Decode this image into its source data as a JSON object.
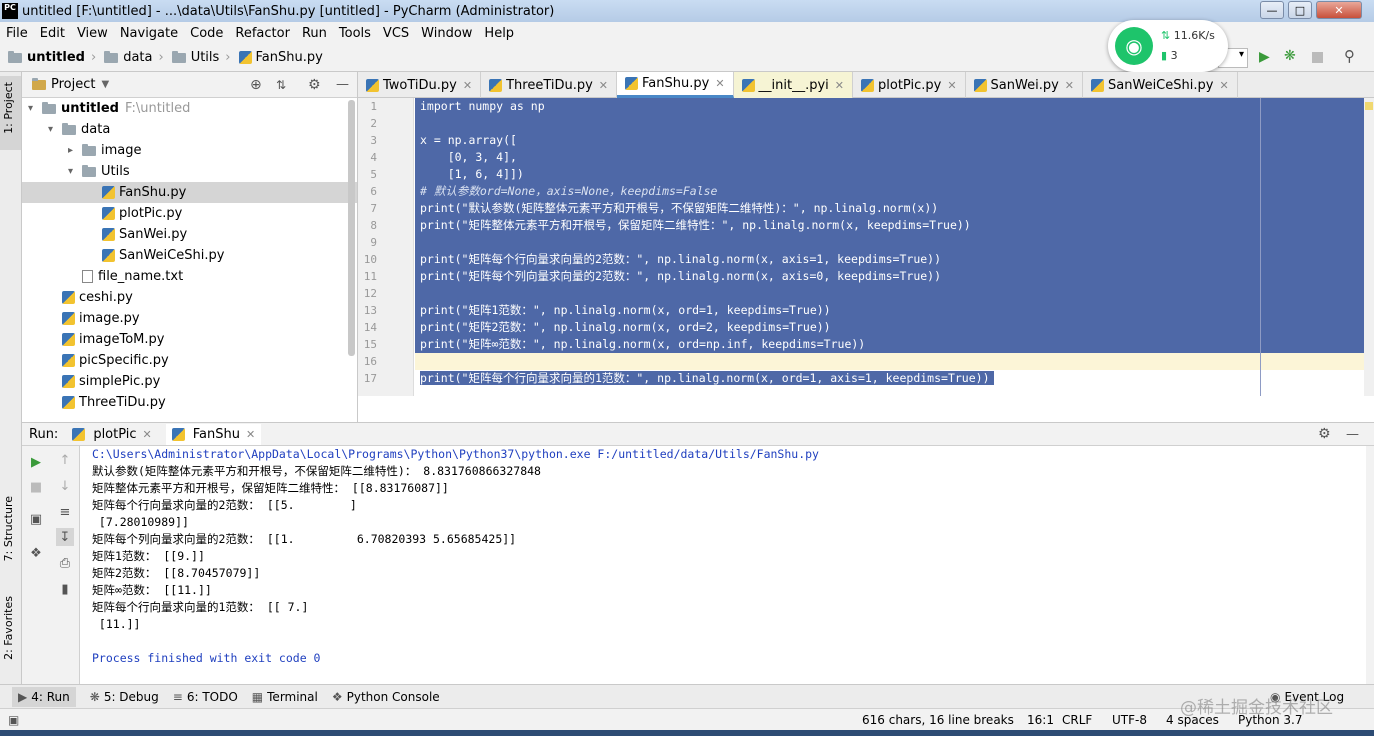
{
  "window": {
    "title": "untitled [F:\\untitled] - ...\\data\\Utils\\FanShu.py [untitled] - PyCharm (Administrator)",
    "app_icon": "PC",
    "controls": [
      "minimize",
      "maximize",
      "close"
    ]
  },
  "menu": [
    "File",
    "Edit",
    "View",
    "Navigate",
    "Code",
    "Refactor",
    "Run",
    "Tools",
    "VCS",
    "Window",
    "Help"
  ],
  "breadcrumb": [
    "untitled",
    "data",
    "Utils",
    "FanShu.py"
  ],
  "network_widget": {
    "speed": "11.6K/s",
    "count": "3"
  },
  "project_panel": {
    "title": "Project",
    "tree": [
      {
        "label": "untitled",
        "path": "F:\\untitled",
        "depth": 0,
        "type": "folder",
        "expanded": true
      },
      {
        "label": "data",
        "depth": 1,
        "type": "folder",
        "expanded": true
      },
      {
        "label": "image",
        "depth": 2,
        "type": "folder",
        "expanded": false
      },
      {
        "label": "Utils",
        "depth": 2,
        "type": "folder",
        "expanded": true
      },
      {
        "label": "FanShu.py",
        "depth": 3,
        "type": "py",
        "selected": true
      },
      {
        "label": "plotPic.py",
        "depth": 3,
        "type": "py"
      },
      {
        "label": "SanWei.py",
        "depth": 3,
        "type": "py"
      },
      {
        "label": "SanWeiCeShi.py",
        "depth": 3,
        "type": "py"
      },
      {
        "label": "file_name.txt",
        "depth": 2,
        "type": "txt"
      },
      {
        "label": "ceshi.py",
        "depth": 1,
        "type": "py"
      },
      {
        "label": "image.py",
        "depth": 1,
        "type": "py"
      },
      {
        "label": "imageToM.py",
        "depth": 1,
        "type": "py"
      },
      {
        "label": "picSpecific.py",
        "depth": 1,
        "type": "py"
      },
      {
        "label": "simplePic.py",
        "depth": 1,
        "type": "py"
      },
      {
        "label": "ThreeTiDu.py",
        "depth": 1,
        "type": "py"
      }
    ]
  },
  "side_tabs": {
    "project": "1: Project",
    "structure": "7: Structure",
    "favorites": "2: Favorites"
  },
  "editor_tabs": [
    {
      "label": "TwoTiDu.py"
    },
    {
      "label": "ThreeTiDu.py"
    },
    {
      "label": "FanShu.py",
      "active": true
    },
    {
      "label": "__init__.pyi"
    },
    {
      "label": "plotPic.py"
    },
    {
      "label": "SanWei.py"
    },
    {
      "label": "SanWeiCeShi.py"
    }
  ],
  "code_lines": [
    "import numpy as np",
    "",
    "x = np.array([",
    "    [0, 3, 4],",
    "    [1, 6, 4]])",
    "# 默认参数ord=None，axis=None，keepdims=False",
    "print(\"默认参数(矩阵整体元素平方和开根号，不保留矩阵二维特性)：\", np.linalg.norm(x))",
    "print(\"矩阵整体元素平方和开根号，保留矩阵二维特性：\", np.linalg.norm(x, keepdims=True))",
    "",
    "print(\"矩阵每个行向量求向量的2范数：\", np.linalg.norm(x, axis=1, keepdims=True))",
    "print(\"矩阵每个列向量求向量的2范数：\", np.linalg.norm(x, axis=0, keepdims=True))",
    "",
    "print(\"矩阵1范数：\", np.linalg.norm(x, ord=1, keepdims=True))",
    "print(\"矩阵2范数：\", np.linalg.norm(x, ord=2, keepdims=True))",
    "print(\"矩阵∞范数：\", np.linalg.norm(x, ord=np.inf, keepdims=True))",
    "",
    "print(\"矩阵每个行向量求向量的1范数：\", np.linalg.norm(x, ord=1, axis=1, keepdims=True))"
  ],
  "run_panel": {
    "label": "Run:",
    "tabs": [
      "plotPic",
      "FanShu"
    ],
    "output": [
      "C:\\Users\\Administrator\\AppData\\Local\\Programs\\Python\\Python37\\python.exe F:/untitled/data/Utils/FanShu.py",
      "默认参数(矩阵整体元素平方和开根号，不保留矩阵二维特性)： 8.831760866327848",
      "矩阵整体元素平方和开根号，保留矩阵二维特性： [[8.83176087]]",
      "矩阵每个行向量求向量的2范数： [[5.        ]",
      " [7.28010989]]",
      "矩阵每个列向量求向量的2范数： [[1.         6.70820393 5.65685425]]",
      "矩阵1范数： [[9.]]",
      "矩阵2范数： [[8.70457079]]",
      "矩阵∞范数： [[11.]]",
      "矩阵每个行向量求向量的1范数： [[ 7.]",
      " [11.]]",
      "",
      "Process finished with exit code 0"
    ]
  },
  "bottom_tabs": [
    "4: Run",
    "5: Debug",
    "6: TODO",
    "Terminal",
    "Python Console",
    "Event Log"
  ],
  "status": {
    "chars": "616 chars, 16 line breaks",
    "position": "16:1",
    "line_sep": "CRLF",
    "encoding": "UTF-8",
    "indent": "4 spaces",
    "interpreter": "Python 3.7",
    "watermark": "@稀土掘金技术社区"
  }
}
